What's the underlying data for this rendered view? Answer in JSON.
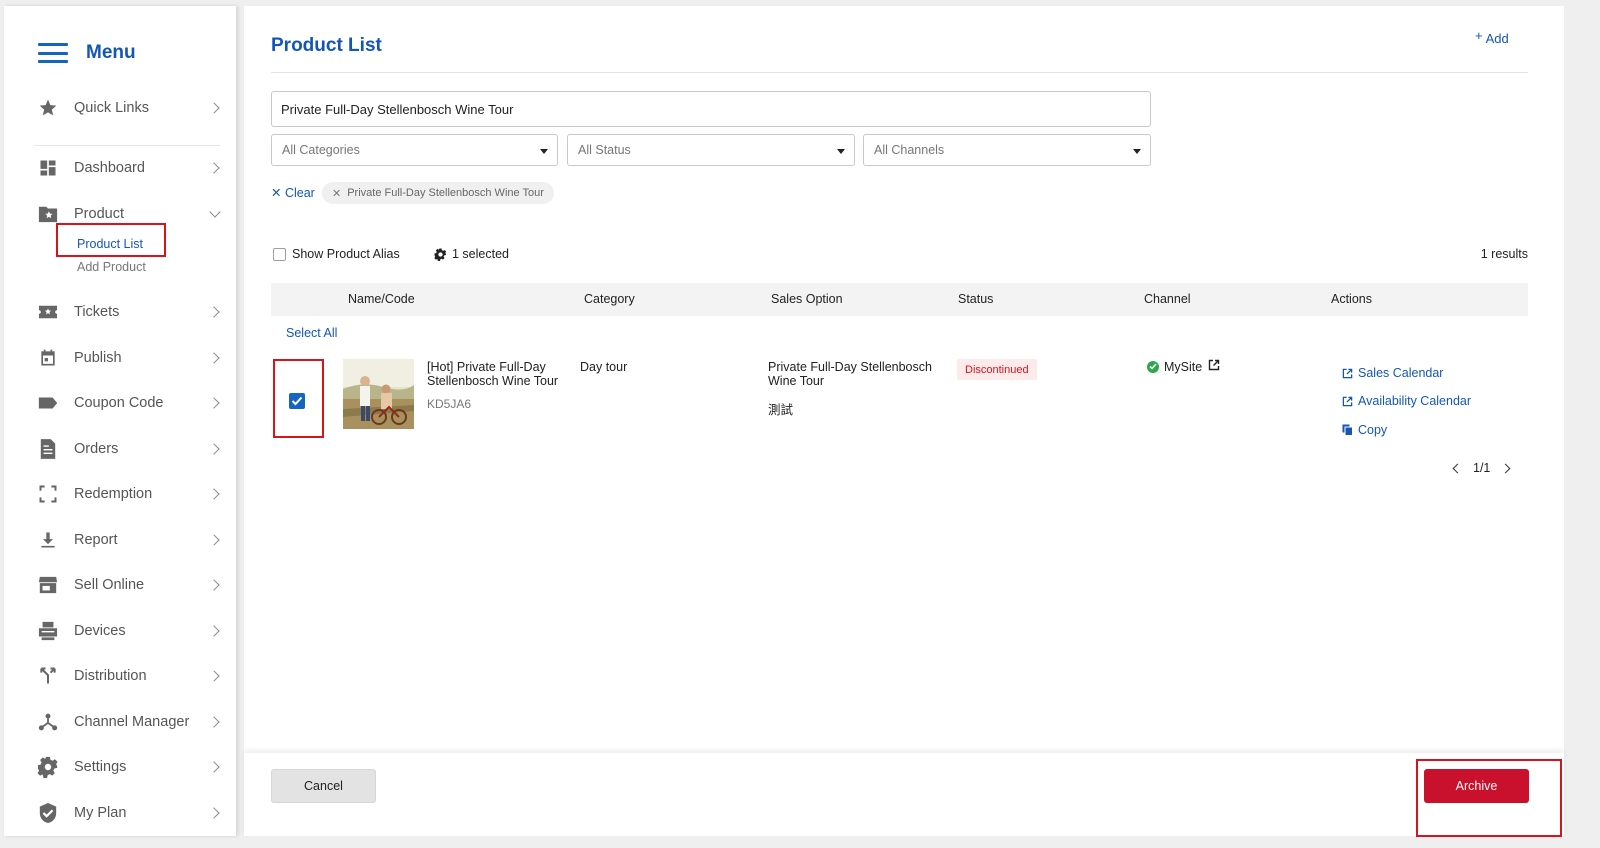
{
  "sidebar": {
    "title": "Menu",
    "items": [
      {
        "label": "Quick Links",
        "icon": "star-icon"
      },
      {
        "label": "Dashboard",
        "icon": "dashboard-icon"
      },
      {
        "label": "Product",
        "icon": "folder-star-icon",
        "expanded": true
      },
      {
        "label": "Tickets",
        "icon": "ticket-icon"
      },
      {
        "label": "Publish",
        "icon": "calendar-icon"
      },
      {
        "label": "Coupon Code",
        "icon": "tag-icon"
      },
      {
        "label": "Orders",
        "icon": "document-icon"
      },
      {
        "label": "Redemption",
        "icon": "scan-frame-icon"
      },
      {
        "label": "Report",
        "icon": "download-icon"
      },
      {
        "label": "Sell Online",
        "icon": "store-icon"
      },
      {
        "label": "Devices",
        "icon": "printer-icon"
      },
      {
        "label": "Distribution",
        "icon": "fork-icon"
      },
      {
        "label": "Channel Manager",
        "icon": "network-icon"
      },
      {
        "label": "Settings",
        "icon": "gear-icon"
      },
      {
        "label": "My Plan",
        "icon": "shield-check-icon"
      }
    ],
    "product_sub": {
      "active": "Product List",
      "other": "Add Product"
    }
  },
  "header": {
    "title": "Product List",
    "add_label": "Add"
  },
  "filters": {
    "search_value": "Private Full-Day Stellenbosch Wine Tour",
    "categories": "All Categories",
    "status": "All Status",
    "channels": "All Channels",
    "clear_label": "Clear",
    "chip_label": "Private Full-Day Stellenbosch Wine Tour"
  },
  "toolbar": {
    "alias_label": "Show Product Alias",
    "selected_label": "1 selected",
    "results_label": "1 results"
  },
  "table": {
    "headers": [
      "Name/Code",
      "Category",
      "Sales Option",
      "Status",
      "Channel",
      "Actions"
    ],
    "select_all": "Select All",
    "row": {
      "checked": true,
      "name": "[Hot] Private Full-Day Stellenbosch Wine Tour",
      "code": "KD5JA6",
      "category": "Day tour",
      "sales_option": "Private Full-Day Stellenbosch Wine Tour",
      "sales_option_alt": "測試",
      "status": "Discontinued",
      "channel": "MySite",
      "actions": [
        "Sales Calendar",
        "Availability Calendar",
        "Copy"
      ]
    }
  },
  "pagination": {
    "label": "1/1"
  },
  "footer": {
    "cancel_label": "Cancel",
    "archive_label": "Archive"
  },
  "colors": {
    "accent": "#1456b8",
    "danger": "#c9102c",
    "highlight": "#d7141e",
    "success": "#2ba84a"
  }
}
